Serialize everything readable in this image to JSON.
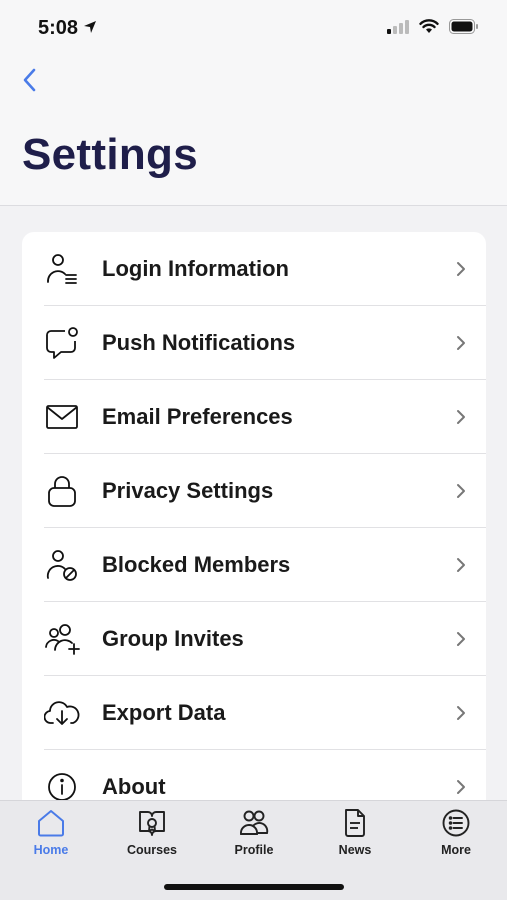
{
  "status_bar": {
    "time": "5:08"
  },
  "header": {
    "title": "Settings"
  },
  "settings_items": [
    {
      "label": "Login Information",
      "icon": "user-lines-icon"
    },
    {
      "label": "Push Notifications",
      "icon": "chat-bubble-badge-icon"
    },
    {
      "label": "Email Preferences",
      "icon": "envelope-icon"
    },
    {
      "label": "Privacy Settings",
      "icon": "lock-icon"
    },
    {
      "label": "Blocked Members",
      "icon": "user-blocked-icon"
    },
    {
      "label": "Group Invites",
      "icon": "group-add-icon"
    },
    {
      "label": "Export Data",
      "icon": "cloud-download-icon"
    },
    {
      "label": "About",
      "icon": "info-icon"
    }
  ],
  "tab_bar": [
    {
      "label": "Home",
      "icon": "home-icon",
      "active": true
    },
    {
      "label": "Courses",
      "icon": "book-icon",
      "active": false
    },
    {
      "label": "Profile",
      "icon": "people-icon",
      "active": false
    },
    {
      "label": "News",
      "icon": "document-icon",
      "active": false
    },
    {
      "label": "More",
      "icon": "list-icon",
      "active": false
    }
  ],
  "colors": {
    "accent": "#4a7be8",
    "title": "#1f1e4a",
    "background": "#f2f2f4",
    "card": "#ffffff"
  }
}
